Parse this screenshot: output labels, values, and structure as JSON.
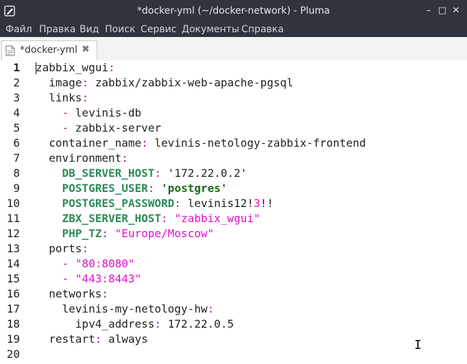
{
  "window": {
    "title": "*docker-yml (~/docker-network) - Pluma",
    "minimize": "–",
    "maximize": "□",
    "close": "✕"
  },
  "menu": [
    "Файл",
    "Правка",
    "Вид",
    "Поиск",
    "Сервис",
    "Документы",
    "Справка"
  ],
  "tab": {
    "label": "*docker-yml",
    "close": "✖"
  },
  "editor": {
    "current_line": 1,
    "line_numbers": [
      "1",
      "2",
      "3",
      "4",
      "5",
      "6",
      "7",
      "8",
      "9",
      "10",
      "11",
      "12",
      "13",
      "14",
      "15",
      "16",
      "17",
      "18",
      "19",
      "20"
    ],
    "lines": [
      [
        [
          "k",
          "zabbix_wgui"
        ],
        [
          "c",
          ":"
        ]
      ],
      [
        [
          "p",
          "  "
        ],
        [
          "k",
          "image"
        ],
        [
          "c",
          ":"
        ],
        [
          "p",
          " zabbix/zabbix-web-apache-pgsql"
        ]
      ],
      [
        [
          "p",
          "  "
        ],
        [
          "k",
          "links"
        ],
        [
          "c",
          ":"
        ]
      ],
      [
        [
          "p",
          "    "
        ],
        [
          "c",
          "- "
        ],
        [
          "p",
          "levinis-db"
        ]
      ],
      [
        [
          "p",
          "    "
        ],
        [
          "c",
          "- "
        ],
        [
          "p",
          "zabbix-server"
        ]
      ],
      [
        [
          "p",
          "  "
        ],
        [
          "k",
          "container_name"
        ],
        [
          "c",
          ":"
        ],
        [
          "p",
          " levinis-netology-zabbix-frontend"
        ]
      ],
      [
        [
          "p",
          "  "
        ],
        [
          "k",
          "environment"
        ],
        [
          "c",
          ":"
        ]
      ],
      [
        [
          "p",
          "    "
        ],
        [
          "e",
          "DB_SERVER_HOST"
        ],
        [
          "c",
          ":"
        ],
        [
          "p",
          " '172.22.0.2'"
        ]
      ],
      [
        [
          "p",
          "    "
        ],
        [
          "e",
          "POSTGRES_USER"
        ],
        [
          "c",
          ":"
        ],
        [
          "p",
          " "
        ],
        [
          "q",
          "'postgres'"
        ]
      ],
      [
        [
          "p",
          "    "
        ],
        [
          "e",
          "POSTGRES_PASSWORD"
        ],
        [
          "c",
          ":"
        ],
        [
          "p",
          " levinis12!"
        ],
        [
          "n",
          "3"
        ],
        [
          "p",
          "!!"
        ]
      ],
      [
        [
          "p",
          "    "
        ],
        [
          "e",
          "ZBX_SERVER_HOST"
        ],
        [
          "c",
          ":"
        ],
        [
          "p",
          " "
        ],
        [
          "s",
          "\"zabbix_wgui\""
        ]
      ],
      [
        [
          "p",
          "    "
        ],
        [
          "e",
          "PHP_TZ"
        ],
        [
          "c",
          ":"
        ],
        [
          "p",
          " "
        ],
        [
          "s",
          "\"Europe/Moscow\""
        ]
      ],
      [
        [
          "p",
          "  "
        ],
        [
          "k",
          "ports"
        ],
        [
          "c",
          ":"
        ]
      ],
      [
        [
          "p",
          "    "
        ],
        [
          "c",
          "- "
        ],
        [
          "s",
          "\"80:8080\""
        ]
      ],
      [
        [
          "p",
          "    "
        ],
        [
          "c",
          "- "
        ],
        [
          "s",
          "\"443:8443\""
        ]
      ],
      [
        [
          "p",
          "  "
        ],
        [
          "k",
          "networks"
        ],
        [
          "c",
          ":"
        ]
      ],
      [
        [
          "p",
          "    "
        ],
        [
          "k",
          "levinis-my-netology-hw"
        ],
        [
          "c",
          ":"
        ]
      ],
      [
        [
          "p",
          "      "
        ],
        [
          "k",
          "ipv4_address"
        ],
        [
          "c",
          ":"
        ],
        [
          "p",
          " 172.22.0.5"
        ]
      ],
      [
        [
          "p",
          "  "
        ],
        [
          "k",
          "restart"
        ],
        [
          "c",
          ":"
        ],
        [
          "p",
          " always"
        ]
      ],
      [
        [
          "p",
          ""
        ]
      ]
    ]
  },
  "colors": {
    "titlebar": "#2f343f",
    "keyword": "#222222",
    "colon": "#a020a0",
    "string": "#e010d0",
    "env_key": "#2e8b57",
    "single_quoted": "#1a6b1a"
  }
}
